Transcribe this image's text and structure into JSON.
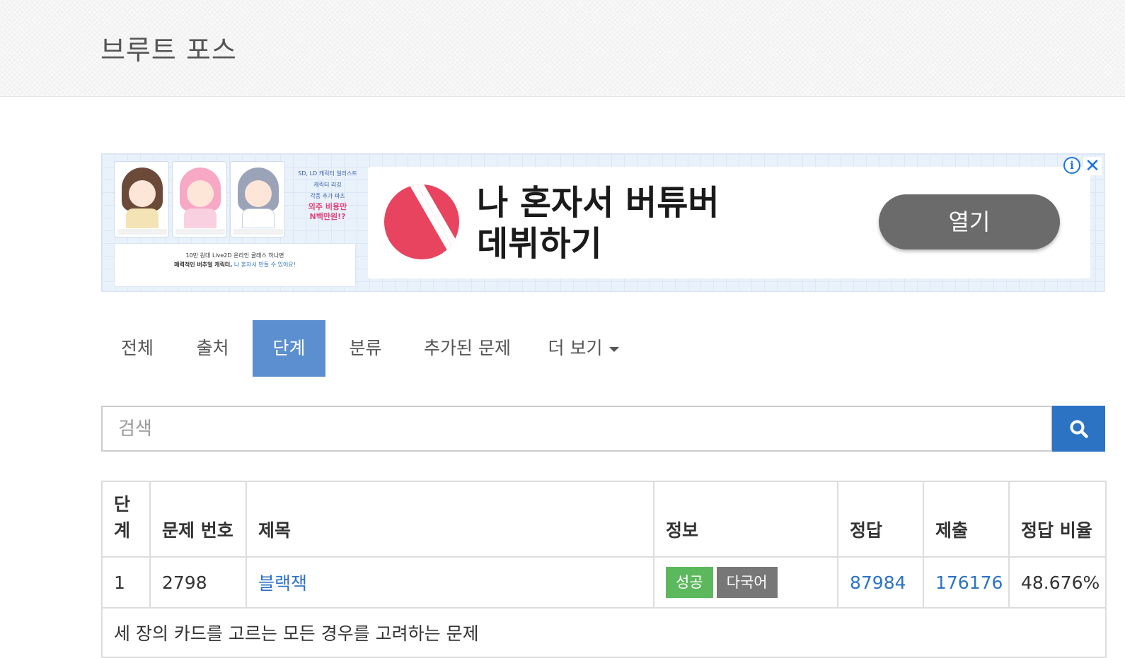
{
  "page": {
    "title": "브루트 포스"
  },
  "ad": {
    "headline_line1": "나 혼자서 버튜버",
    "headline_line2": "데뷔하기",
    "open_button": "열기",
    "info_icon": "info-icon",
    "close_icon": "close-icon",
    "creative": {
      "side_lines": [
        "SD, LD 캐릭터 일러스트",
        "캐릭터 리깅",
        "각종 추가 파츠"
      ],
      "side_highlight": [
        "외주 비용만",
        "N백만원!?"
      ],
      "caption_line1": "10만 원대 Live2D 온라인 클래스 하나면",
      "caption_line2_bold": "매력적인 버추얼 캐릭터,",
      "caption_line2_link": "나 혼자서 만들 수 있어요!"
    },
    "logo_color": "#e8445f"
  },
  "tabs": [
    {
      "label": "전체",
      "active": false
    },
    {
      "label": "출처",
      "active": false
    },
    {
      "label": "단계",
      "active": true
    },
    {
      "label": "분류",
      "active": false
    },
    {
      "label": "추가된 문제",
      "active": false
    },
    {
      "label": "더 보기",
      "active": false,
      "dropdown": true
    }
  ],
  "search": {
    "placeholder": "검색",
    "value": "",
    "button_icon": "search-icon"
  },
  "table": {
    "headers": {
      "level": "단계",
      "problem_id": "문제 번호",
      "title": "제목",
      "info": "정보",
      "accepted": "정답",
      "submissions": "제출",
      "ratio": "정답 비율"
    },
    "rows": [
      {
        "level": "1",
        "problem_id": "2798",
        "title": "블랙잭",
        "labels": [
          "성공",
          "다국어"
        ],
        "accepted": "87984",
        "submissions": "176176",
        "ratio": "48.676%",
        "description": "세 장의 카드를 고르는 모든 경우를 고려하는 문제"
      }
    ]
  },
  "colors": {
    "primary": "#2c73c4",
    "active_tab": "#5b8fd0",
    "success_label": "#5cb85c",
    "default_label": "#777777"
  }
}
